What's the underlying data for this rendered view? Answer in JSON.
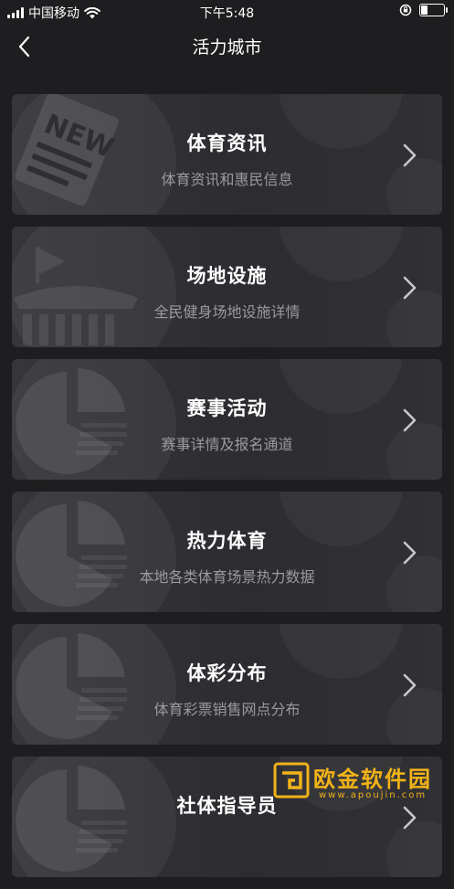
{
  "status_bar": {
    "carrier": "中国移动",
    "time": "下午5:48",
    "signal_bars": 4,
    "battery_level": 0.3
  },
  "nav": {
    "title": "活力城市",
    "back_icon": "chevron-left-icon"
  },
  "cards": [
    {
      "title": "体育资讯",
      "subtitle": "体育资讯和惠民信息",
      "deco_icon": "newspaper-icon"
    },
    {
      "title": "场地设施",
      "subtitle": "全民健身场地设施详情",
      "deco_icon": "stadium-icon"
    },
    {
      "title": "赛事活动",
      "subtitle": "赛事详情及报名通道",
      "deco_icon": "pie-chart-icon"
    },
    {
      "title": "热力体育",
      "subtitle": "本地各类体育场景热力数据",
      "deco_icon": "pie-chart-icon"
    },
    {
      "title": "体彩分布",
      "subtitle": "体育彩票销售网点分布",
      "deco_icon": "pie-chart-icon"
    },
    {
      "title": "社体指导员",
      "subtitle": "",
      "deco_icon": "pie-chart-icon"
    }
  ],
  "watermark": {
    "name": "欧金软件园",
    "url": "www.apoujin.com",
    "color": "#f2b318"
  },
  "colors": {
    "background": "#1e1e20",
    "card": "#323236",
    "subtitle": "#9a9a9e",
    "accent": "#f2b318"
  }
}
